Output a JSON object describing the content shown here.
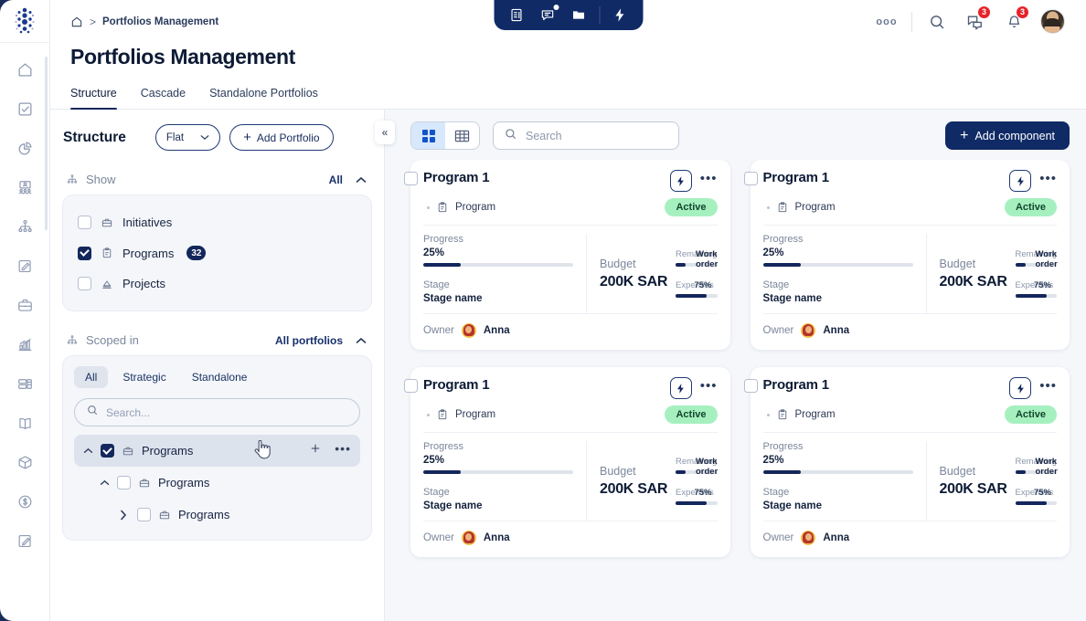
{
  "breadcrumb": {
    "home_icon": "home-icon",
    "separator": ">",
    "label": "Portfolios Management"
  },
  "page": {
    "title": "Portfolios Management"
  },
  "center_toolbar": {
    "buttons": [
      {
        "icon": "document-list-icon",
        "name": "documents"
      },
      {
        "icon": "chat-bubble-icon",
        "name": "messages",
        "dot": true
      },
      {
        "icon": "folder-icon",
        "name": "folders"
      },
      {
        "icon": "bolt-icon",
        "name": "quick-actions"
      }
    ]
  },
  "top_right": {
    "more_label": "ooo",
    "search_icon": "search-icon",
    "chat_icon": "chat-icon",
    "chat_badge": "3",
    "bell_icon": "bell-icon",
    "bell_badge": "3",
    "avatar": "user-avatar"
  },
  "tabs": [
    {
      "label": "Structure",
      "active": true
    },
    {
      "label": "Cascade",
      "active": false
    },
    {
      "label": "Standalone Portfolios",
      "active": false
    }
  ],
  "left_panel": {
    "title": "Structure",
    "select_value": "Flat",
    "add_portfolio_label": "Add Portfolio",
    "plus": "+",
    "show": {
      "header": "Show",
      "right_label": "All",
      "rows": [
        {
          "label": "Initiatives",
          "checked": false,
          "icon": "briefcase-icon",
          "count": null
        },
        {
          "label": "Programs",
          "checked": true,
          "icon": "clipboard-icon",
          "count": "32"
        },
        {
          "label": "Projects",
          "checked": false,
          "icon": "project-icon",
          "count": null
        }
      ]
    },
    "scoped": {
      "header": "Scoped in",
      "right_label": "All portfolios",
      "segments": [
        {
          "label": "All",
          "active": true
        },
        {
          "label": "Strategic",
          "active": false
        },
        {
          "label": "Standalone",
          "active": false
        }
      ],
      "search_placeholder": "Search...",
      "search_value": "",
      "tree": [
        {
          "label": "Programs",
          "checked": true,
          "expanded": true,
          "depth": 0,
          "selected": true,
          "actions": [
            "plus-icon",
            "more-icon"
          ]
        },
        {
          "label": "Programs",
          "checked": false,
          "expanded": true,
          "depth": 1,
          "selected": false,
          "actions": []
        },
        {
          "label": "Programs",
          "checked": false,
          "expanded": false,
          "depth": 2,
          "selected": false,
          "actions": []
        }
      ]
    }
  },
  "right_panel": {
    "collapse_label": "«",
    "view_modes": [
      {
        "icon": "grid-view-icon",
        "active": true
      },
      {
        "icon": "table-view-icon",
        "active": false
      }
    ],
    "search_placeholder": "Search",
    "search_value": "",
    "add_component_label": "Add component",
    "add_component_plus": "+",
    "cards": [
      {
        "title": "Program 1",
        "type_label": "Program",
        "status": "Active",
        "progress_label": "Progress",
        "progress_value": "25%",
        "progress_pct": 25,
        "stage_label": "Stage",
        "stage_value": "Stage name",
        "budget_label": "Budget",
        "budget_value": "200K SAR",
        "remaining_label": "Remaining",
        "workorder_label": "Work order",
        "remaining_pct": 25,
        "expenses_label": "Expenses",
        "expenses_value": "75%",
        "expenses_pct": 75,
        "owner_label": "Owner",
        "owner_name": "Anna"
      },
      {
        "title": "Program 1",
        "type_label": "Program",
        "status": "Active",
        "progress_label": "Progress",
        "progress_value": "25%",
        "progress_pct": 25,
        "stage_label": "Stage",
        "stage_value": "Stage name",
        "budget_label": "Budget",
        "budget_value": "200K SAR",
        "remaining_label": "Remaining",
        "workorder_label": "Work order",
        "remaining_pct": 25,
        "expenses_label": "Expenses",
        "expenses_value": "75%",
        "expenses_pct": 75,
        "owner_label": "Owner",
        "owner_name": "Anna"
      },
      {
        "title": "Program 1",
        "type_label": "Program",
        "status": "Active",
        "progress_label": "Progress",
        "progress_value": "25%",
        "progress_pct": 25,
        "stage_label": "Stage",
        "stage_value": "Stage name",
        "budget_label": "Budget",
        "budget_value": "200K SAR",
        "remaining_label": "Remaining",
        "workorder_label": "Work order",
        "remaining_pct": 25,
        "expenses_label": "Expenses",
        "expenses_value": "75%",
        "expenses_pct": 75,
        "owner_label": "Owner",
        "owner_name": "Anna"
      },
      {
        "title": "Program 1",
        "type_label": "Program",
        "status": "Active",
        "progress_label": "Progress",
        "progress_value": "25%",
        "progress_pct": 25,
        "stage_label": "Stage",
        "stage_value": "Stage name",
        "budget_label": "Budget",
        "budget_value": "200K SAR",
        "remaining_label": "Remaining",
        "workorder_label": "Work order",
        "remaining_pct": 25,
        "expenses_label": "Expenses",
        "expenses_value": "75%",
        "expenses_pct": 75,
        "owner_label": "Owner",
        "owner_name": "Anna"
      }
    ]
  },
  "rail": {
    "logo": "company-logo",
    "icons": [
      "home-icon",
      "checkbox-task-icon",
      "pie-chart-icon",
      "people-card-icon",
      "hierarchy-icon",
      "edit-board-icon",
      "briefcase-icon",
      "bar-chart-icon",
      "layout-icon",
      "book-icon",
      "cube-icon",
      "dollar-circle-icon",
      "signature-icon"
    ]
  },
  "colors": {
    "brand_navy": "#102a66",
    "dark_navy": "#14275c",
    "accent_blue": "#1552c7",
    "status_green_bg": "#a6f0c0",
    "badge_red": "#e8222a",
    "panel_bg": "#f5f7fa"
  }
}
